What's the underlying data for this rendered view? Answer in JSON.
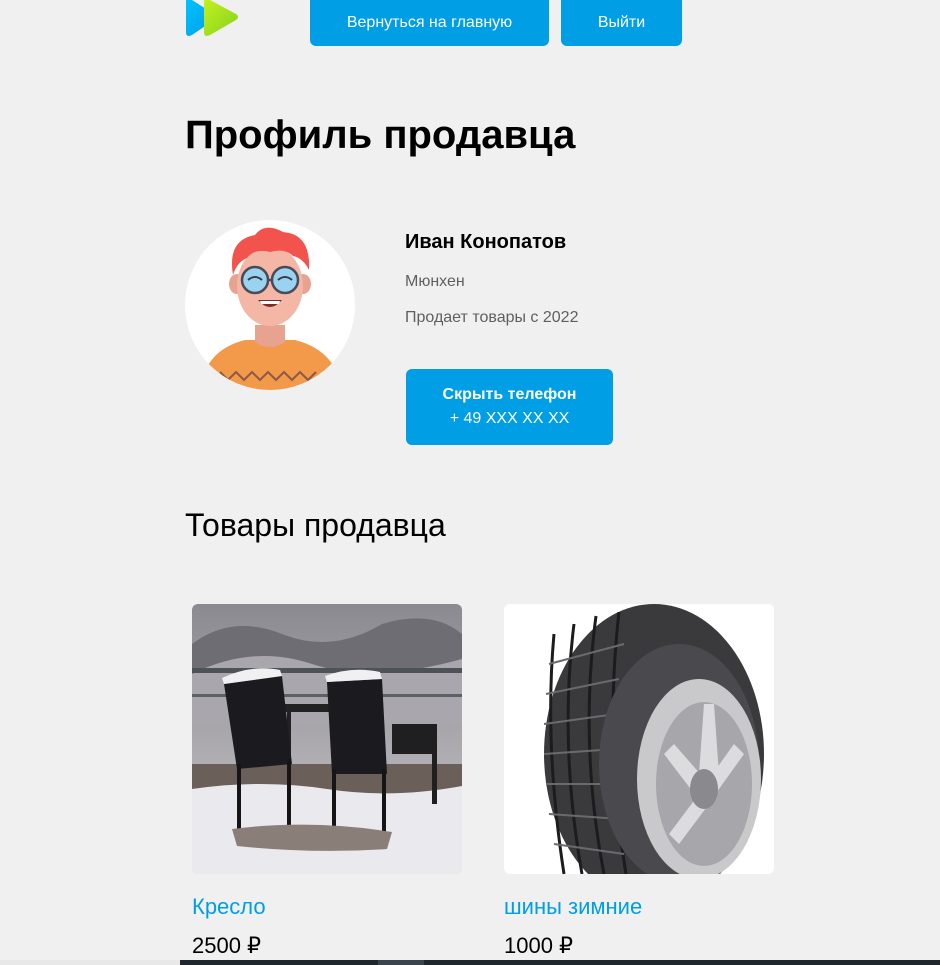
{
  "header": {
    "home_button": "Вернуться на главную",
    "logout_button": "Выйти"
  },
  "page_title": "Профиль продавца",
  "seller": {
    "name": "Иван Конопатов",
    "city": "Мюнхен",
    "since": "Продает товары с 2022",
    "phone_button_label": "Скрыть телефон",
    "phone": "+ 49 XXX XX XX"
  },
  "products_title": "Товары продавца",
  "products": [
    {
      "title": "Кресло",
      "price": "2500 ₽"
    },
    {
      "title": "шины зимние",
      "price": "1000 ₽"
    }
  ],
  "colors": {
    "accent": "#009ee4",
    "background": "#f0f0f0",
    "muted_text": "#5f5f5f"
  },
  "icons": {
    "logo": "logo-icon",
    "avatar": "user-avatar"
  }
}
